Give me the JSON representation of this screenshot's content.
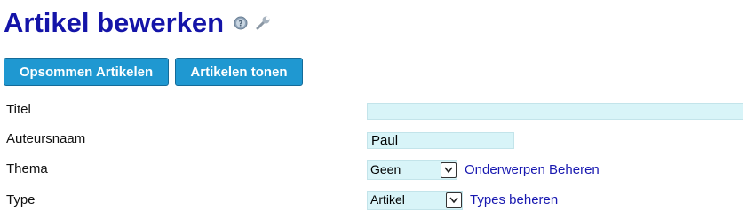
{
  "page": {
    "title": "Artikel bewerken"
  },
  "icons": {
    "help": "help-icon",
    "settings": "wrench-icon"
  },
  "toolbar": {
    "list_label": "Opsommen Artikelen",
    "show_label": "Artikelen tonen"
  },
  "form": {
    "titel": {
      "label": "Titel",
      "value": ""
    },
    "auteursnaam": {
      "label": "Auteursnaam",
      "value": "Paul"
    },
    "thema": {
      "label": "Thema",
      "selected": "Geen",
      "link": "Onderwerpen Beheren"
    },
    "type": {
      "label": "Type",
      "selected": "Artikel",
      "link": "Types beheren"
    }
  },
  "colors": {
    "title": "#1414a8",
    "button": "#1f98d1",
    "field_bg": "#d8f4f8",
    "link": "#1818b0"
  }
}
